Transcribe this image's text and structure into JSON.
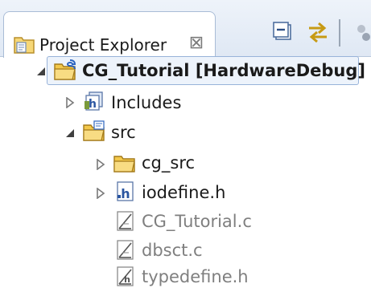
{
  "view": {
    "tab_title": "Project Explorer",
    "tab_icon": "project-explorer-icon",
    "close_glyph": "⊠",
    "toolbar": [
      {
        "name": "collapse-all-button",
        "icon": "collapse-all-icon"
      },
      {
        "name": "link-with-editor-button",
        "icon": "link-with-editor-icon"
      }
    ]
  },
  "tree": {
    "project": {
      "label": "CG_Tutorial [HardwareDebug]",
      "icon": "project-folder-icon",
      "expanded": true
    },
    "includes": {
      "label": "Includes",
      "icon": "includes-icon",
      "expanded": false
    },
    "src": {
      "label": "src",
      "icon": "source-folder-icon",
      "expanded": true
    },
    "cg_src": {
      "label": "cg_src",
      "icon": "folder-icon",
      "expanded": false
    },
    "files": [
      {
        "label": "iodefine.h",
        "icon": "header-file-icon",
        "excluded": false
      },
      {
        "label": "CG_Tutorial.c",
        "icon": "excluded-c-file-icon",
        "excluded": true
      },
      {
        "label": "dbsct.c",
        "icon": "excluded-c-file-icon",
        "excluded": true
      },
      {
        "label": "typedefine.h",
        "icon": "excluded-header-file-icon",
        "excluded": true
      }
    ]
  },
  "colors": {
    "selection_bg": "#edf3fb",
    "selection_border": "#98b3d9",
    "excluded_text": "#7f7f7f",
    "folder_yellow": "#f3c84b"
  }
}
